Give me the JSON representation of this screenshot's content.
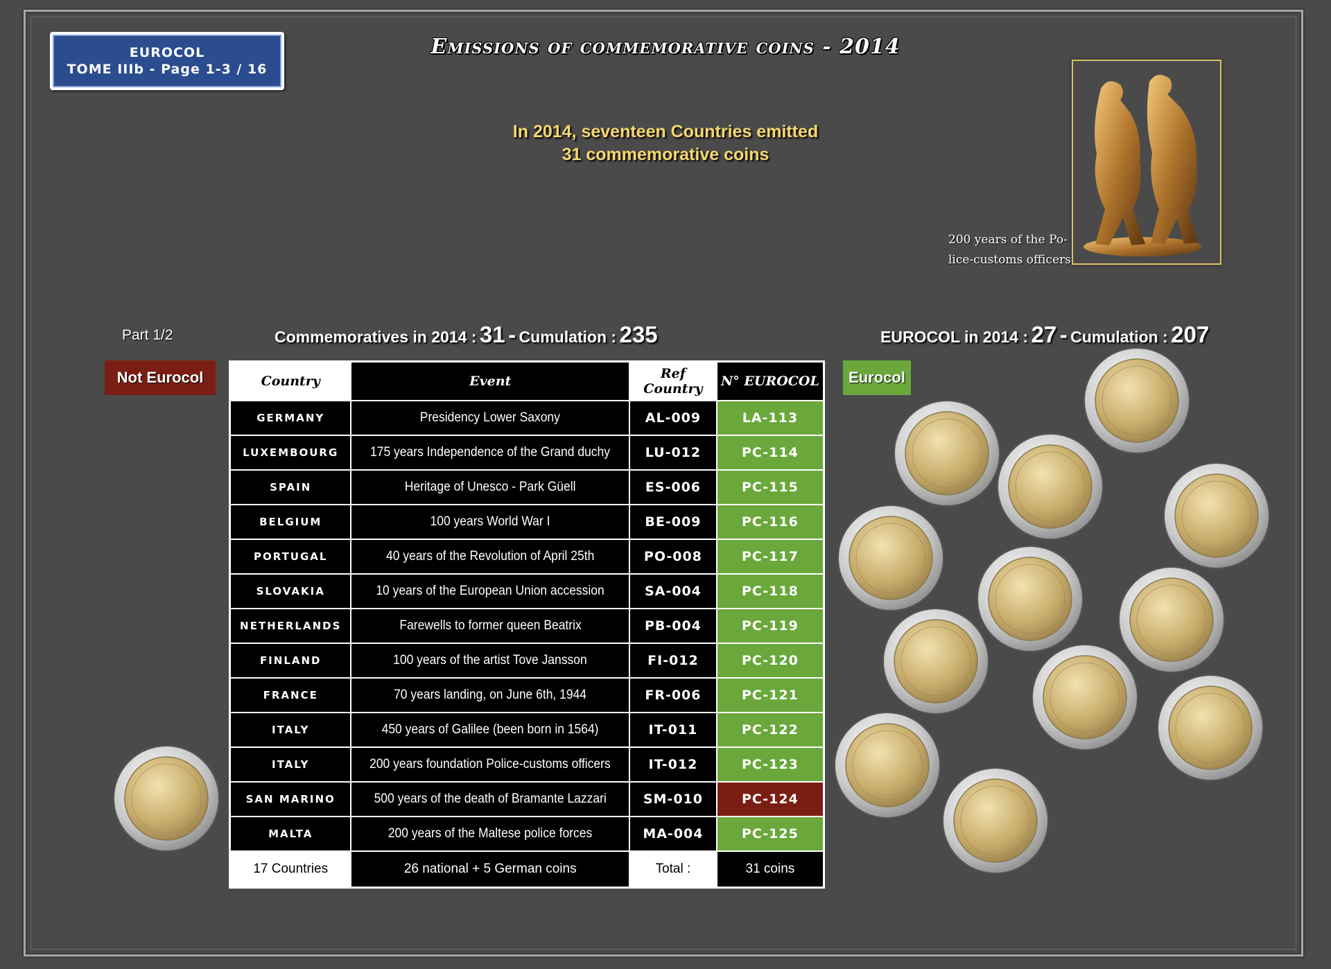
{
  "header": {
    "tome_line1": "EUROCOL",
    "tome_line2": "TOME IIIb - Page 1-3 / 16",
    "title": "Emissions of commemorative coins - 2014",
    "intro_line1": "In 2014, seventeen Countries emitted",
    "intro_line2": "31 commemorative coins",
    "statue_caption_line1": "200 years of the Po-",
    "statue_caption_line2": "lice-customs officers"
  },
  "part_label": "Part 1/2",
  "stats_left": {
    "label": "Commemoratives in 2014 :",
    "value": "31",
    "sep": "-",
    "cum_label": "Cumulation :",
    "cum_value": "235"
  },
  "stats_right": {
    "label": "EUROCOL in 2014 :",
    "value": "27",
    "sep": "-",
    "cum_label": "Cumulation :",
    "cum_value": "207"
  },
  "badges": {
    "not_eurocol": "Not Eurocol",
    "eurocol": "Eurocol"
  },
  "table": {
    "headers": [
      "Country",
      "Event",
      "Ref Country",
      "N° EUROCOL"
    ],
    "rows": [
      {
        "country": "GERMANY",
        "event": "Presidency Lower Saxony",
        "ref": "AL-009",
        "num": "LA-113",
        "status": "eurocol"
      },
      {
        "country": "LUXEMBOURG",
        "event": "175 years Independence of the Grand duchy",
        "ref": "LU-012",
        "num": "PC-114",
        "status": "eurocol"
      },
      {
        "country": "SPAIN",
        "event": "Heritage of Unesco - Park Güell",
        "ref": "ES-006",
        "num": "PC-115",
        "status": "eurocol"
      },
      {
        "country": "BELGIUM",
        "event": "100 years World War I",
        "ref": "BE-009",
        "num": "PC-116",
        "status": "eurocol"
      },
      {
        "country": "PORTUGAL",
        "event": "40 years of the Revolution of April 25th",
        "ref": "PO-008",
        "num": "PC-117",
        "status": "eurocol"
      },
      {
        "country": "SLOVAKIA",
        "event": "10 years of the European Union accession",
        "ref": "SA-004",
        "num": "PC-118",
        "status": "eurocol"
      },
      {
        "country": "NETHERLANDS",
        "event": "Farewells to former queen Beatrix",
        "ref": "PB-004",
        "num": "PC-119",
        "status": "eurocol"
      },
      {
        "country": "FINLAND",
        "event": "100 years of  the artist Tove Jansson",
        "ref": "FI-012",
        "num": "PC-120",
        "status": "eurocol"
      },
      {
        "country": "FRANCE",
        "event": "70 years landing, on June 6th, 1944",
        "ref": "FR-006",
        "num": "PC-121",
        "status": "eurocol"
      },
      {
        "country": "ITALY",
        "event": "450 years of Galilee (been born in 1564)",
        "ref": "IT-011",
        "num": "PC-122",
        "status": "eurocol"
      },
      {
        "country": "ITALY",
        "event": "200 years foundation Police-customs officers",
        "ref": "IT-012",
        "num": "PC-123",
        "status": "eurocol"
      },
      {
        "country": "SAN MARINO",
        "event": "500 years of the death of Bramante Lazzari",
        "ref": "SM-010",
        "num": "PC-124",
        "status": "not_eurocol"
      },
      {
        "country": "MALTA",
        "event": "200 years of the Maltese police forces",
        "ref": "MA-004",
        "num": "PC-125",
        "status": "eurocol"
      }
    ],
    "footer": {
      "countries": "17 Countries",
      "coins_breakdown": "26 national + 5 German coins",
      "total_label": "Total :",
      "total_value": "31 coins"
    }
  },
  "colors": {
    "background": "#4a4a4a",
    "eurocol_green": "#6aa83c",
    "not_eurocol_red": "#7a1e14",
    "tome_blue": "#2b4c8e",
    "intro_yellow": "#f5d76e"
  }
}
